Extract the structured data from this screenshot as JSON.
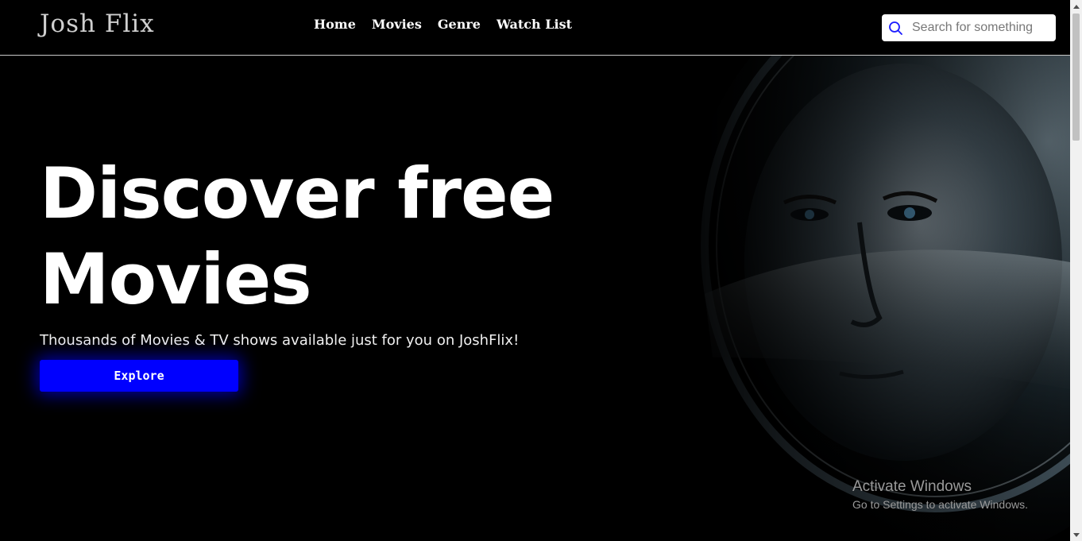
{
  "header": {
    "logo": "Josh Flix",
    "nav": [
      "Home",
      "Movies",
      "Genre",
      "Watch List"
    ],
    "search_placeholder": "Search for something"
  },
  "hero": {
    "title_line1": "Discover free",
    "title_line2": "Movies",
    "subtitle": "Thousands of Movies & TV shows available just for you on JoshFlix!",
    "button": "Explore",
    "image_icon": "astronaut-helmet-image"
  },
  "watermark": {
    "line1": "Activate Windows",
    "line2": "Go to Settings to activate Windows."
  },
  "colors": {
    "background": "#000000",
    "accent": "#0000ff",
    "search_icon": "#1a1aff"
  },
  "icons": {
    "search": "search-icon",
    "scroll_up": "chevron-up-icon",
    "scroll_down": "chevron-down-icon"
  }
}
